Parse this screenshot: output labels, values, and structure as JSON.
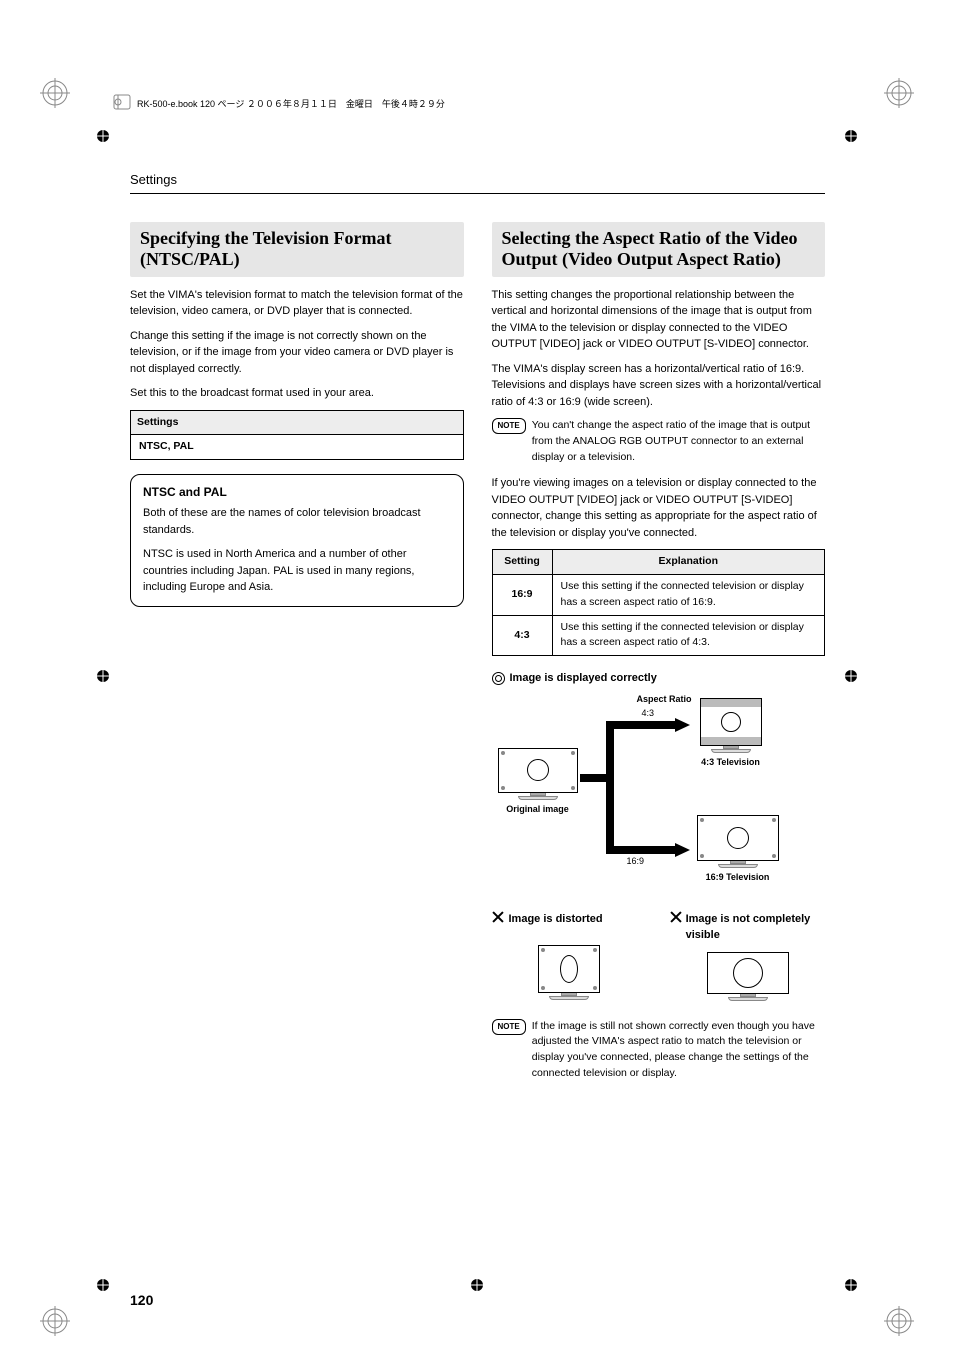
{
  "header": {
    "filename_line": "RK-500-e.book 120 ページ ２００６年８月１１日　金曜日　午後４時２９分"
  },
  "page": {
    "section": "Settings",
    "number": "120"
  },
  "left": {
    "heading": "Specifying the Television Format (NTSC/PAL)",
    "p1": "Set the VIMA's television format to match the television format of the television, video camera, or DVD player that is connected.",
    "p2": "Change this setting if the image is not correctly shown on the television, or if the image from your video camera or DVD player is not displayed correctly.",
    "p3": "Set this to the broadcast format used in your area.",
    "table": {
      "header": "Settings",
      "value": "NTSC, PAL"
    },
    "callout": {
      "title": "NTSC and PAL",
      "p1": "Both of these are the names of color television broadcast standards.",
      "p2": "NTSC is used in North America and a number of other countries including Japan. PAL is used in many regions, including Europe and Asia."
    }
  },
  "right": {
    "heading": "Selecting the Aspect Ratio of the Video Output (Video Output Aspect Ratio)",
    "p1": "This setting changes the proportional relationship between the vertical and horizontal dimensions of the image that is output from the VIMA to the television or display connected to the VIDEO OUTPUT [VIDEO] jack or VIDEO OUTPUT [S-VIDEO] connector.",
    "p2": "The VIMA's display screen has a horizontal/vertical ratio of 16:9. Televisions and displays have screen sizes with a horizontal/vertical ratio of 4:3 or 16:9 (wide screen).",
    "note1_label": "NOTE",
    "note1": "You can't change the aspect ratio of the image that is output from the ANALOG RGB OUTPUT connector to an external display or a television.",
    "p3": "If you're viewing images on a television or display connected to the VIDEO OUTPUT [VIDEO] jack or VIDEO OUTPUT [S-VIDEO] connector, change this setting as appropriate for the aspect ratio of the television or display you've connected.",
    "table": {
      "h1": "Setting",
      "h2": "Explanation",
      "rows": [
        {
          "key": "16:9",
          "val": "Use this setting if the connected television or display has a screen aspect ratio of 16:9."
        },
        {
          "key": "4:3",
          "val": "Use this setting if the connected television or display has a screen aspect ratio of 4:3."
        }
      ]
    },
    "diagram": {
      "correct": "Image is displayed correctly",
      "aspect_label": "Aspect Ratio",
      "r43": "4:3",
      "r169": "16:9",
      "original": "Original image",
      "tv43": "4:3 Television",
      "tv169": "16:9 Television",
      "bad1": "Image is distorted",
      "bad2": "Image is not completely visible"
    },
    "note2_label": "NOTE",
    "note2": "If the image is still not shown correctly even though you have adjusted the VIMA's aspect ratio to match the television or display you've connected, please change the settings of the connected television or display."
  }
}
